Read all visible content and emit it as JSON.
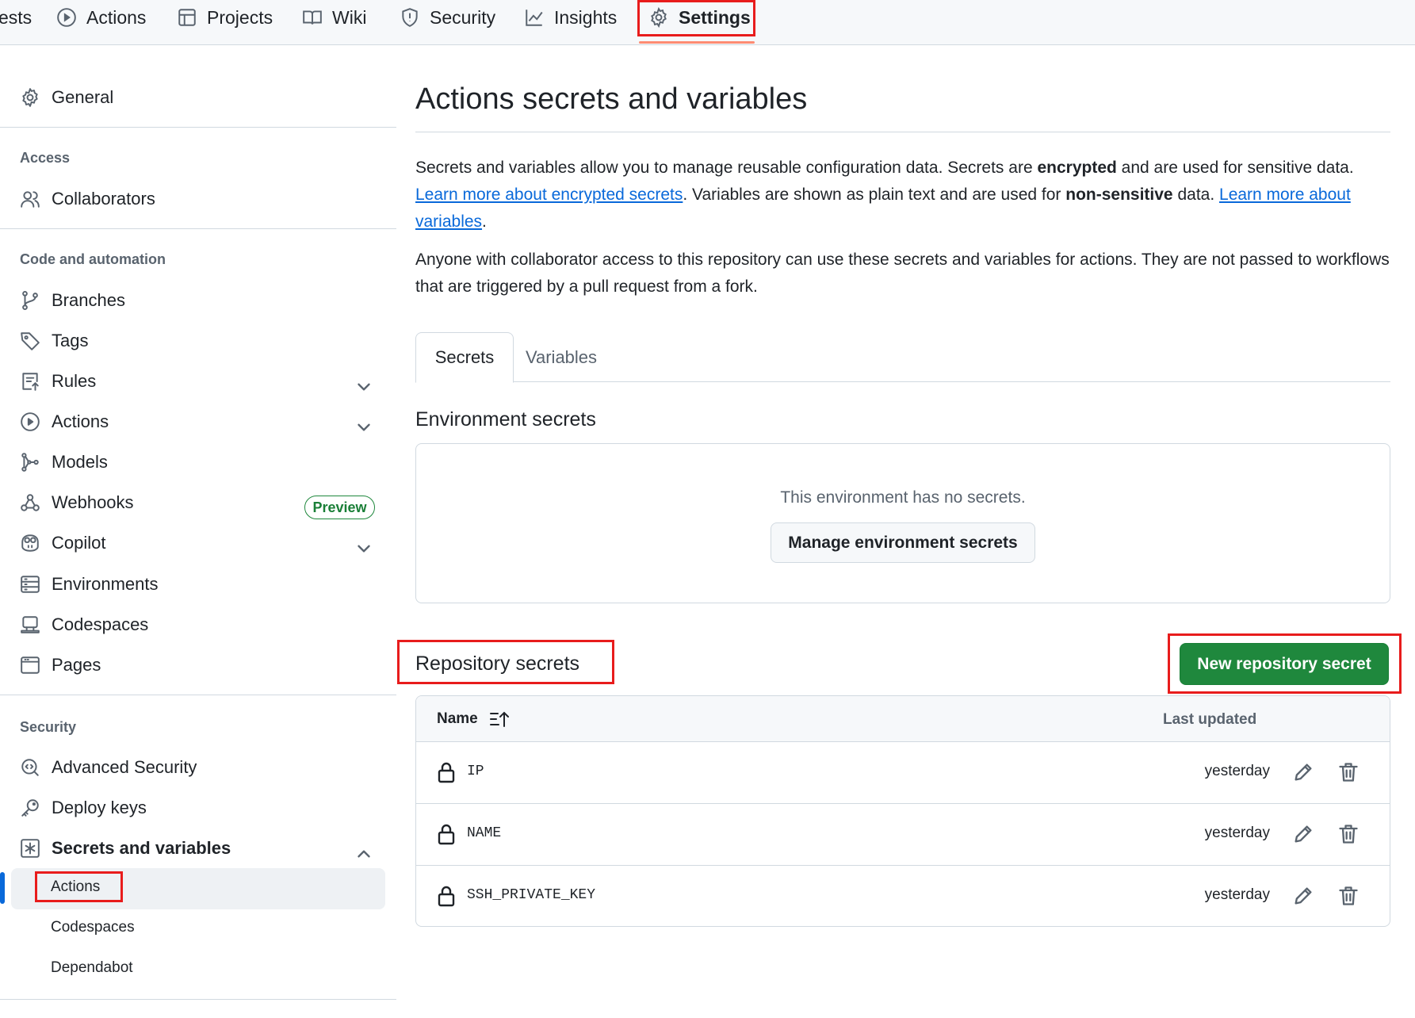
{
  "repo_nav": {
    "items": [
      {
        "label": "ests",
        "icon": "pull-request-icon"
      },
      {
        "label": "Actions",
        "icon": "play-circle-icon"
      },
      {
        "label": "Projects",
        "icon": "table-icon"
      },
      {
        "label": "Wiki",
        "icon": "book-icon"
      },
      {
        "label": "Security",
        "icon": "shield-icon"
      },
      {
        "label": "Insights",
        "icon": "graph-icon"
      },
      {
        "label": "Settings",
        "icon": "gear-icon",
        "active": true
      }
    ]
  },
  "sidebar": {
    "general": "General",
    "access_heading": "Access",
    "collaborators": "Collaborators",
    "code_heading": "Code and automation",
    "items": [
      {
        "label": "Branches",
        "icon": "git-branch-icon"
      },
      {
        "label": "Tags",
        "icon": "tag-icon"
      },
      {
        "label": "Rules",
        "icon": "rules-icon"
      },
      {
        "label": "Actions",
        "icon": "play-circle-icon"
      },
      {
        "label": "Models",
        "icon": "models-icon"
      },
      {
        "label": "Webhooks",
        "icon": "webhook-icon"
      },
      {
        "label": "Copilot",
        "icon": "copilot-icon"
      },
      {
        "label": "Environments",
        "icon": "server-icon"
      },
      {
        "label": "Codespaces",
        "icon": "codespaces-icon"
      },
      {
        "label": "Pages",
        "icon": "browser-icon"
      }
    ],
    "models_badge": "Preview",
    "security_heading": "Security",
    "advanced_security": "Advanced Security",
    "deploy_keys": "Deploy keys",
    "secrets_and_variables": "Secrets and variables",
    "sub_items": [
      "Actions",
      "Codespaces",
      "Dependabot"
    ]
  },
  "main": {
    "title": "Actions secrets and variables",
    "intro": {
      "p1_a": "Secrets and variables allow you to manage reusable configuration data. Secrets are ",
      "p1_b": "encrypted",
      "p1_c": " and are used for sensitive data. ",
      "p1_link1": "Learn more about encrypted secrets",
      "p1_d": ". Variables are shown as plain text and are used for ",
      "p1_e": "non-sensitive",
      "p1_f": " data. ",
      "p1_link2": "Learn more about variables",
      "p1_g": ".",
      "p2": "Anyone with collaborator access to this repository can use these secrets and variables for actions. They are not passed to workflows that are triggered by a pull request from a fork."
    },
    "tabs": [
      "Secrets",
      "Variables"
    ],
    "env_heading": "Environment secrets",
    "env_empty": "This environment has no secrets.",
    "env_button": "Manage environment secrets",
    "repo_heading": "Repository secrets",
    "new_button": "New repository secret",
    "table": {
      "col_name": "Name",
      "col_updated": "Last updated",
      "rows": [
        {
          "name": "IP",
          "updated": "yesterday"
        },
        {
          "name": "NAME",
          "updated": "yesterday"
        },
        {
          "name": "SSH_PRIVATE_KEY",
          "updated": "yesterday"
        }
      ]
    }
  },
  "colors": {
    "primary_button": "#1f883d",
    "link": "#0969da",
    "highlight_box": "#e81c1c",
    "active_tab_underline": "#fd8c73"
  }
}
